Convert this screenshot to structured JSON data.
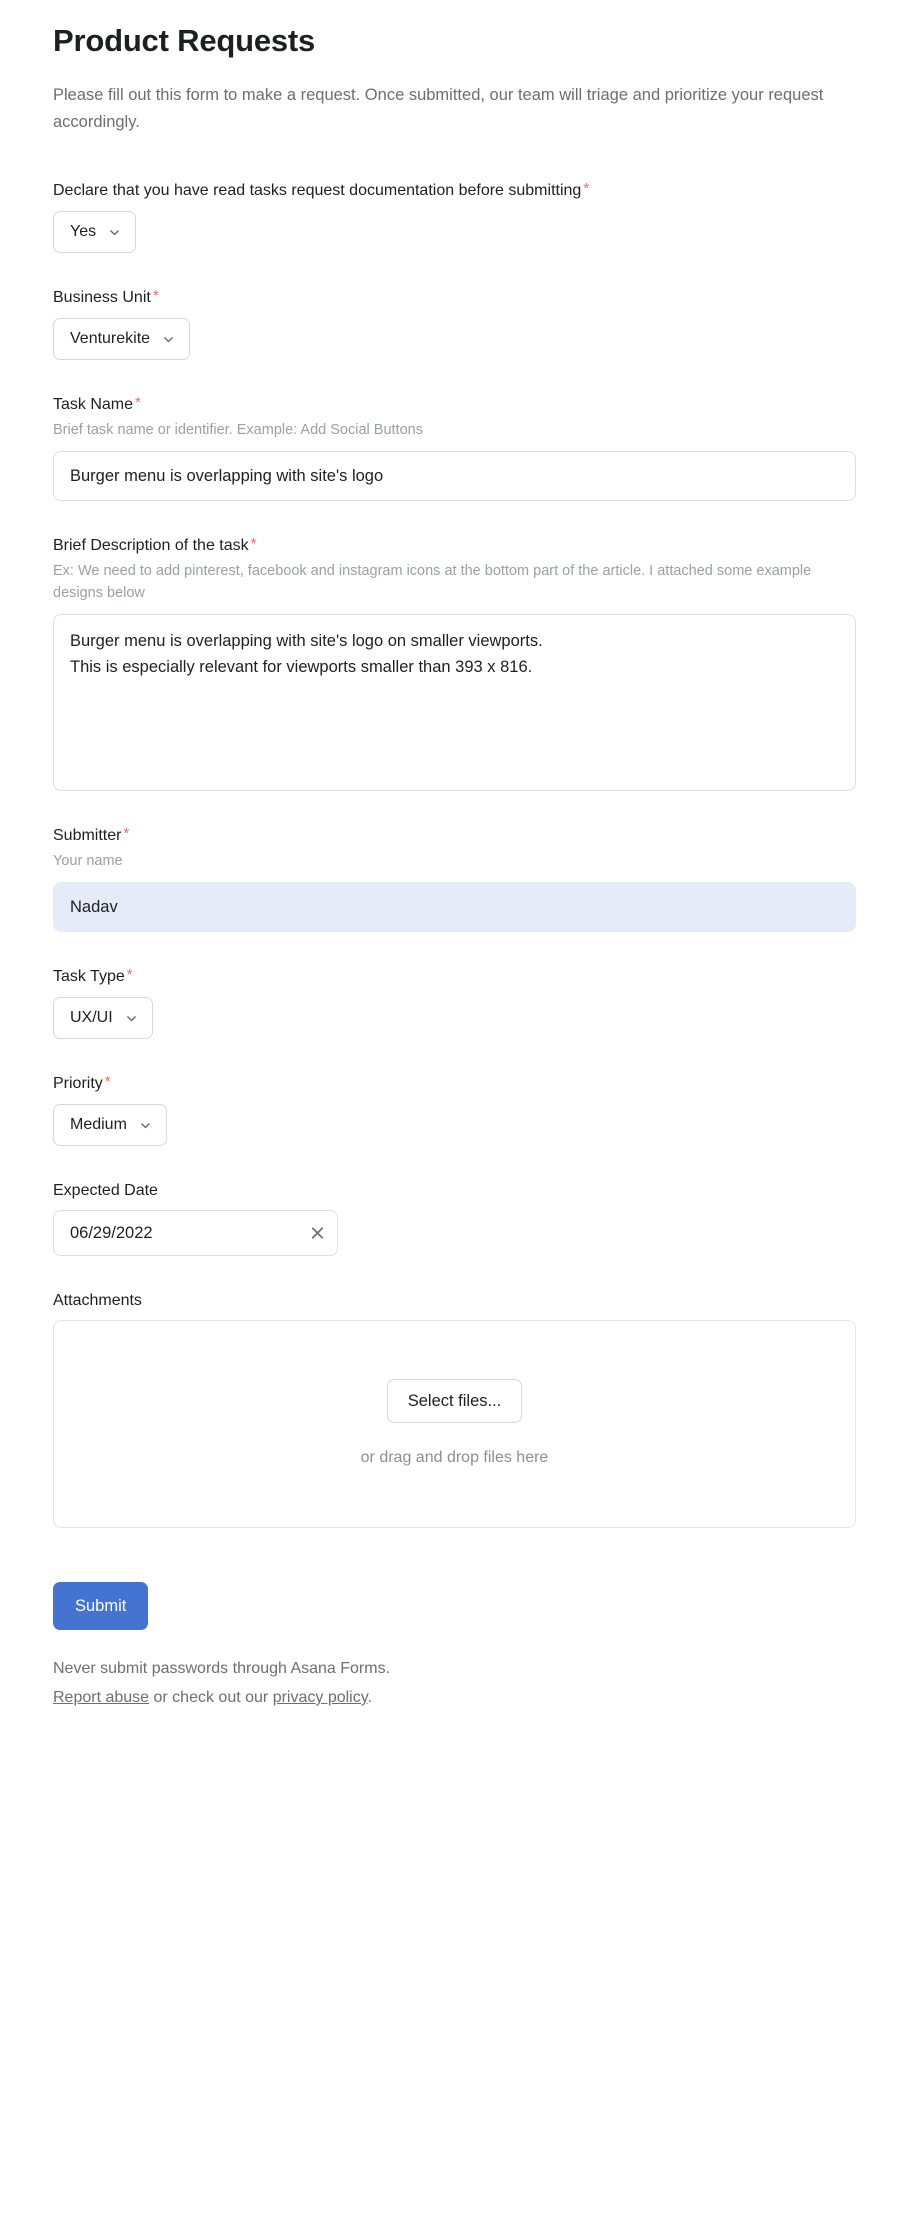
{
  "form": {
    "title": "Product Requests",
    "description": "Please fill out this form to make a request. Once submitted, our team will triage and prioritize your request accordingly.",
    "required_marker": "*"
  },
  "colors": {
    "accent_blue": "#4573d2",
    "required_red": "#f06a6a",
    "filled_field_bg": "#e6ebfa",
    "text_primary": "#1e1f21",
    "text_muted": "#6d6e6f",
    "border": "#dedfe0"
  },
  "fields": {
    "declaration": {
      "label": "Declare that you have read tasks request documentation before submitting",
      "required": true,
      "value": "Yes",
      "icon": "chevron-down-icon"
    },
    "business_unit": {
      "label": "Business Unit",
      "required": true,
      "value": "Venturekite",
      "icon": "chevron-down-icon"
    },
    "task_name": {
      "label": "Task Name",
      "required": true,
      "hint": "Brief task name or identifier. Example: Add Social Buttons",
      "value": "Burger menu is overlapping with site's logo",
      "placeholder": ""
    },
    "brief_description": {
      "label": "Brief Description of the task",
      "required": true,
      "hint": "Ex: We need to add pinterest, facebook and instagram icons at the bottom part of the article. I attached some example designs below",
      "value": "Burger menu is overlapping with site's logo on smaller viewports.\nThis is especially relevant for viewports smaller than 393 x 816.",
      "placeholder": ""
    },
    "submitter": {
      "label": "Submitter",
      "required": true,
      "hint": "Your name",
      "value": "Nadav",
      "placeholder": ""
    },
    "task_type": {
      "label": "Task Type",
      "required": true,
      "value": "UX/UI",
      "icon": "chevron-down-icon"
    },
    "priority": {
      "label": "Priority",
      "required": true,
      "value": "Medium",
      "icon": "chevron-down-icon"
    },
    "expected_date": {
      "label": "Expected Date",
      "required": false,
      "value": "06/29/2022",
      "placeholder": "",
      "clear_icon": "close-icon"
    },
    "attachments": {
      "label": "Attachments",
      "required": false,
      "select_files_label": "Select files...",
      "drag_hint": "or drag and drop files here"
    }
  },
  "footer": {
    "submit_label": "Submit",
    "warning": "Never submit passwords through Asana Forms.",
    "report_abuse_label": "Report abuse",
    "middle_text": " or check out our ",
    "privacy_policy_label": "privacy policy",
    "end_text": "."
  }
}
